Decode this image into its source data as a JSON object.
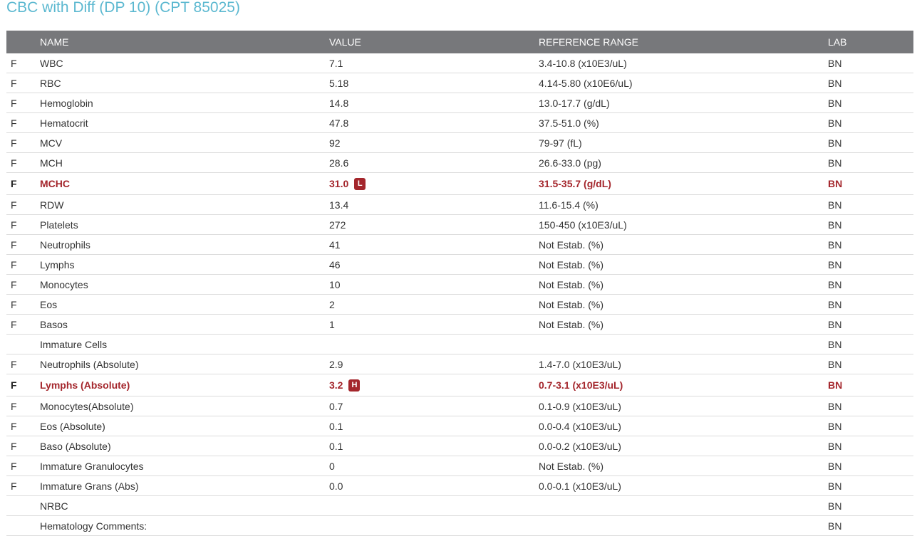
{
  "page": {
    "title": "CBC with Diff (DP 10) (CPT 85025)"
  },
  "table": {
    "headers": {
      "name": "NAME",
      "value": "VALUE",
      "range": "REFERENCE RANGE",
      "lab": "LAB"
    },
    "rows": [
      {
        "flag": "F",
        "name": "WBC",
        "value": "7.1",
        "range": "3.4-10.8 (x10E3/uL)",
        "lab": "BN"
      },
      {
        "flag": "F",
        "name": "RBC",
        "value": "5.18",
        "range": "4.14-5.80 (x10E6/uL)",
        "lab": "BN"
      },
      {
        "flag": "F",
        "name": "Hemoglobin",
        "value": "14.8",
        "range": "13.0-17.7 (g/dL)",
        "lab": "BN"
      },
      {
        "flag": "F",
        "name": "Hematocrit",
        "value": "47.8",
        "range": "37.5-51.0 (%)",
        "lab": "BN"
      },
      {
        "flag": "F",
        "name": "MCV",
        "value": "92",
        "range": "79-97 (fL)",
        "lab": "BN"
      },
      {
        "flag": "F",
        "name": "MCH",
        "value": "28.6",
        "range": "26.6-33.0 (pg)",
        "lab": "BN"
      },
      {
        "flag": "F",
        "name": "MCHC",
        "value": "31.0",
        "badge": "L",
        "range": "31.5-35.7 (g/dL)",
        "lab": "BN"
      },
      {
        "flag": "F",
        "name": "RDW",
        "value": "13.4",
        "range": "11.6-15.4 (%)",
        "lab": "BN"
      },
      {
        "flag": "F",
        "name": "Platelets",
        "value": "272",
        "range": "150-450 (x10E3/uL)",
        "lab": "BN"
      },
      {
        "flag": "F",
        "name": "Neutrophils",
        "value": "41",
        "range": "Not Estab. (%)",
        "lab": "BN"
      },
      {
        "flag": "F",
        "name": "Lymphs",
        "value": "46",
        "range": "Not Estab. (%)",
        "lab": "BN"
      },
      {
        "flag": "F",
        "name": "Monocytes",
        "value": "10",
        "range": "Not Estab. (%)",
        "lab": "BN"
      },
      {
        "flag": "F",
        "name": "Eos",
        "value": "2",
        "range": "Not Estab. (%)",
        "lab": "BN"
      },
      {
        "flag": "F",
        "name": "Basos",
        "value": "1",
        "range": "Not Estab. (%)",
        "lab": "BN"
      },
      {
        "flag": "",
        "name": "Immature Cells",
        "value": "",
        "range": "",
        "lab": "BN"
      },
      {
        "flag": "F",
        "name": "Neutrophils (Absolute)",
        "value": "2.9",
        "range": "1.4-7.0 (x10E3/uL)",
        "lab": "BN"
      },
      {
        "flag": "F",
        "name": "Lymphs (Absolute)",
        "value": "3.2",
        "badge": "H",
        "range": "0.7-3.1 (x10E3/uL)",
        "lab": "BN"
      },
      {
        "flag": "F",
        "name": "Monocytes(Absolute)",
        "value": "0.7",
        "range": "0.1-0.9 (x10E3/uL)",
        "lab": "BN"
      },
      {
        "flag": "F",
        "name": "Eos (Absolute)",
        "value": "0.1",
        "range": "0.0-0.4 (x10E3/uL)",
        "lab": "BN"
      },
      {
        "flag": "F",
        "name": "Baso (Absolute)",
        "value": "0.1",
        "range": "0.0-0.2 (x10E3/uL)",
        "lab": "BN"
      },
      {
        "flag": "F",
        "name": "Immature Granulocytes",
        "value": "0",
        "range": "Not Estab. (%)",
        "lab": "BN"
      },
      {
        "flag": "F",
        "name": "Immature Grans (Abs)",
        "value": "0.0",
        "range": "0.0-0.1 (x10E3/uL)",
        "lab": "BN"
      },
      {
        "flag": "",
        "name": "NRBC",
        "value": "",
        "range": "",
        "lab": "BN"
      },
      {
        "flag": "",
        "name": "Hematology Comments:",
        "value": "",
        "range": "",
        "lab": "BN"
      }
    ]
  },
  "colors": {
    "title": "#5bb8d0",
    "header_bg": "#77787b",
    "abnormal": "#a4262c"
  }
}
